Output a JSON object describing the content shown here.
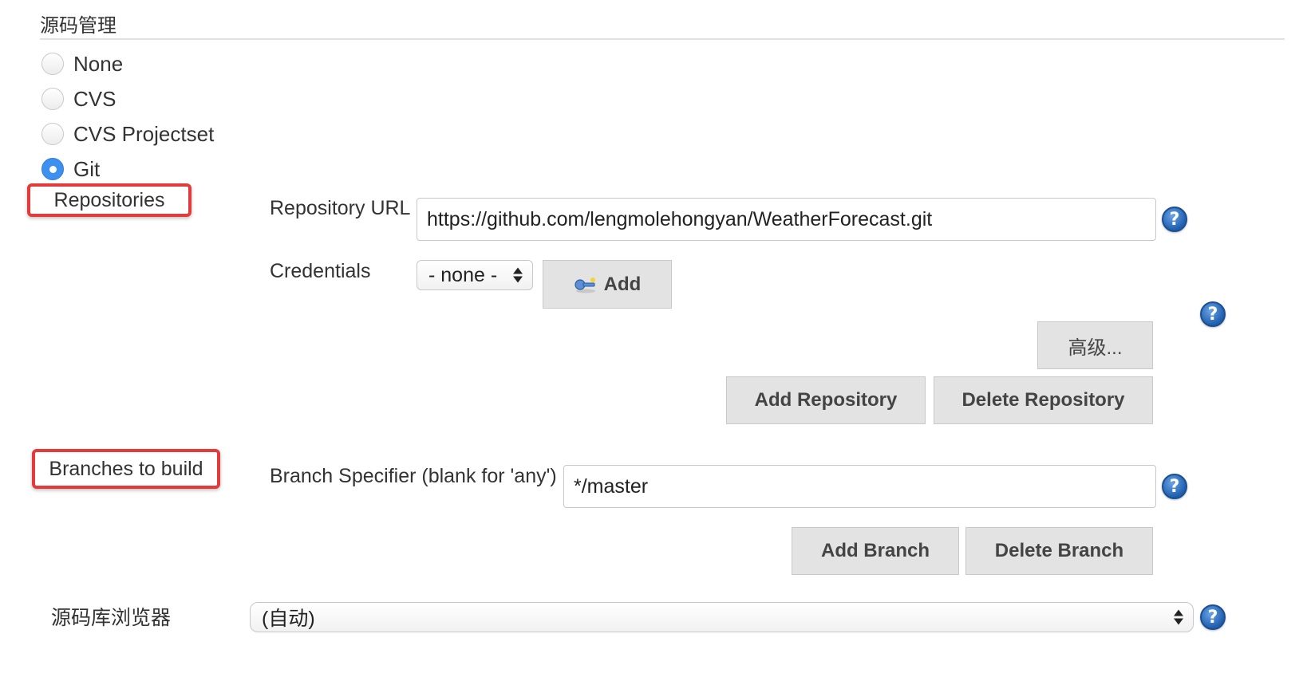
{
  "section": {
    "title": "源码管理"
  },
  "scm_options": [
    {
      "label": "None",
      "checked": false
    },
    {
      "label": "CVS",
      "checked": false
    },
    {
      "label": "CVS Projectset",
      "checked": false
    },
    {
      "label": "Git",
      "checked": true
    }
  ],
  "repositories": {
    "heading": "Repositories",
    "url_label": "Repository URL",
    "url_value": "https://github.com/lengmolehongyan/WeatherForecast.git",
    "credentials_label": "Credentials",
    "credentials_value": "- none -",
    "add_label": "Add",
    "advanced_label": "高级...",
    "add_repository_label": "Add Repository",
    "delete_repository_label": "Delete Repository"
  },
  "branches": {
    "heading": "Branches to build",
    "specifier_label": "Branch Specifier (blank for 'any')",
    "specifier_value": "*/master",
    "add_branch_label": "Add Branch",
    "delete_branch_label": "Delete Branch"
  },
  "browser": {
    "label": "源码库浏览器",
    "value": "(自动)"
  },
  "help": {
    "glyph": "?"
  },
  "colors": {
    "highlight_border": "#e33b3b",
    "radio_selected": "#3d8ff0",
    "help_icon": "#1f5fae",
    "button_bg": "#e3e3e3"
  },
  "icons": {
    "help": "question-circle-icon",
    "credentials_add": "key-icon",
    "select": "up-down-arrows-icon"
  }
}
